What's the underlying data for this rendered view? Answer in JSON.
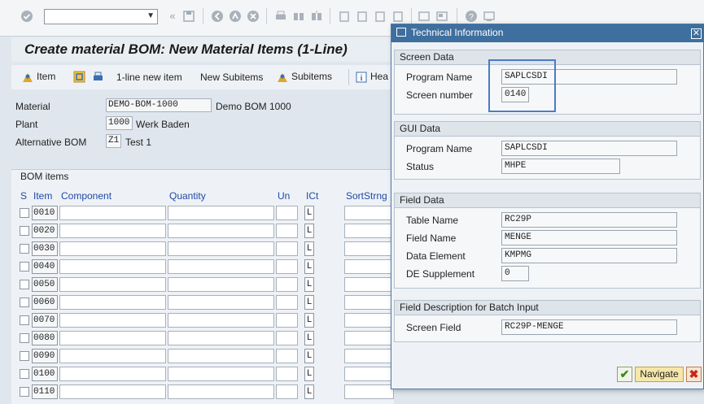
{
  "toolbar": {
    "command_value": "",
    "icons": [
      "check-icon",
      "back-icon",
      "save-icon",
      "back-nav-icon",
      "exit-icon",
      "cancel-icon",
      "print-icon",
      "find-icon",
      "find-next-icon",
      "first-page-icon",
      "previous-page-icon",
      "next-page-icon",
      "last-page-icon",
      "new-session-icon",
      "shortcut-icon",
      "help-icon",
      "customize-layout-icon"
    ]
  },
  "page": {
    "title": "Create material BOM: New Material Items (1-Line)"
  },
  "app_toolbar": {
    "item_label": "Item",
    "one_line_label": "1-line new item",
    "new_subitems_label": "New Subitems",
    "subitems_label": "Subitems",
    "header_label": "Hea"
  },
  "header": {
    "material_label": "Material",
    "material_value": "DEMO-BOM-1000",
    "material_desc": "Demo BOM 1000",
    "plant_label": "Plant",
    "plant_value": "1000",
    "plant_desc": "Werk Baden",
    "altbom_label": "Alternative BOM",
    "altbom_value": "Z1",
    "altbom_desc": "Test 1"
  },
  "bom": {
    "title": "BOM items",
    "columns": {
      "s": "S",
      "item": "Item",
      "component": "Component",
      "quantity": "Quantity",
      "un": "Un",
      "ict": "ICt",
      "sortstrng": "SortStrng"
    },
    "rows": [
      {
        "item": "0010",
        "ict": "L"
      },
      {
        "item": "0020",
        "ict": "L"
      },
      {
        "item": "0030",
        "ict": "L"
      },
      {
        "item": "0040",
        "ict": "L"
      },
      {
        "item": "0050",
        "ict": "L"
      },
      {
        "item": "0060",
        "ict": "L"
      },
      {
        "item": "0070",
        "ict": "L"
      },
      {
        "item": "0080",
        "ict": "L"
      },
      {
        "item": "0090",
        "ict": "L"
      },
      {
        "item": "0100",
        "ict": "L"
      },
      {
        "item": "0110",
        "ict": "L"
      }
    ]
  },
  "dialog": {
    "title": "Technical Information",
    "screen_data": {
      "title": "Screen Data",
      "program_label": "Program Name",
      "program_value": "SAPLCSDI",
      "screen_label": "Screen number",
      "screen_value": "0140"
    },
    "gui_data": {
      "title": "GUI Data",
      "program_label": "Program Name",
      "program_value": "SAPLCSDI",
      "status_label": "Status",
      "status_value": "MHPE"
    },
    "field_data": {
      "title": "Field Data",
      "table_label": "Table Name",
      "table_value": "RC29P",
      "field_label": "Field Name",
      "field_value": "MENGE",
      "element_label": "Data Element",
      "element_value": "KMPMG",
      "supplement_label": "DE Supplement",
      "supplement_value": "0"
    },
    "batch": {
      "title": "Field Description for Batch Input",
      "screen_field_label": "Screen Field",
      "screen_field_value": "RC29P-MENGE"
    },
    "navigate_label": "Navigate"
  },
  "colors": {
    "dialog_header": "#3e6f9e",
    "column_header": "#1f49a6",
    "navigate_bg": "#f6e7a9"
  }
}
